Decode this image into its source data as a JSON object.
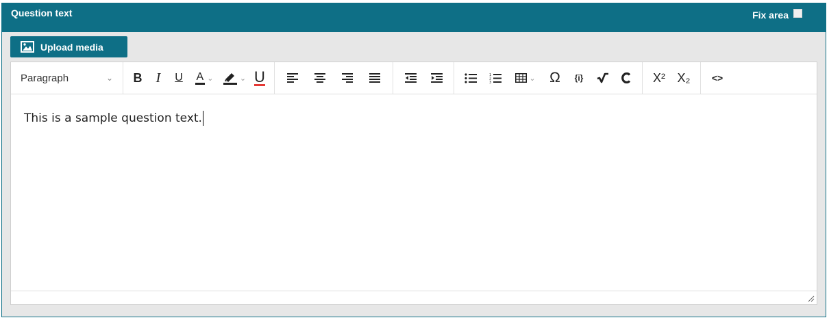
{
  "header": {
    "title": "Question text",
    "fix_area_label": "Fix area"
  },
  "upload": {
    "label": "Upload media"
  },
  "toolbar": {
    "block_format": "Paragraph",
    "bold": "B",
    "italic": "I",
    "underline": "U",
    "font_color": "A",
    "underline_color": "U",
    "special_chars": "Ω",
    "variables": "{i}",
    "superscript": "X²",
    "subscript": "X₂",
    "source_code": "<>"
  },
  "editor": {
    "content": "This is a sample question text."
  },
  "colors": {
    "header_bg": "#0e6f86",
    "panel_bg": "#e7e7e7",
    "underline_red": "#e53935"
  }
}
